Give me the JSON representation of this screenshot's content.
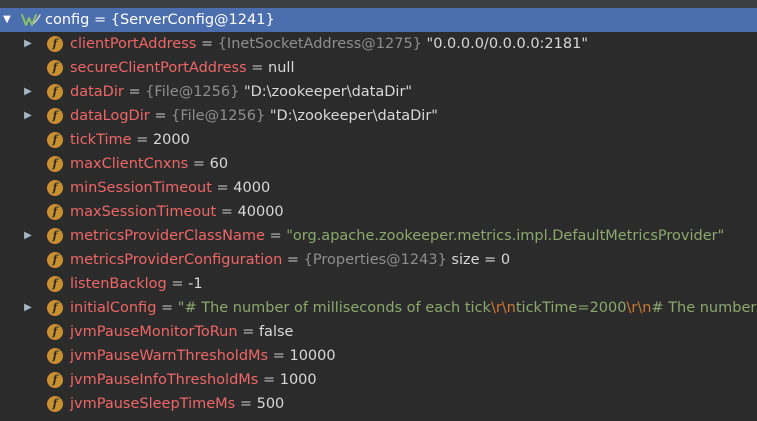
{
  "root": {
    "name": "config",
    "eq": "=",
    "value": "{ServerConfig@1241}"
  },
  "fields": [
    {
      "name": "clientPortAddress",
      "expandable": true,
      "type": "{InetSocketAddress@1275}",
      "value": "\"0.0.0.0/0.0.0.0:2181\""
    },
    {
      "name": "secureClientPortAddress",
      "expandable": false,
      "value": "null"
    },
    {
      "name": "dataDir",
      "expandable": true,
      "type": "{File@1256}",
      "value": "\"D:\\zookeeper\\dataDir\""
    },
    {
      "name": "dataLogDir",
      "expandable": true,
      "type": "{File@1256}",
      "value": "\"D:\\zookeeper\\dataDir\""
    },
    {
      "name": "tickTime",
      "expandable": false,
      "value": "2000"
    },
    {
      "name": "maxClientCnxns",
      "expandable": false,
      "value": "60"
    },
    {
      "name": "minSessionTimeout",
      "expandable": false,
      "value": "4000"
    },
    {
      "name": "maxSessionTimeout",
      "expandable": false,
      "value": "40000"
    },
    {
      "name": "metricsProviderClassName",
      "expandable": true,
      "string": "\"org.apache.zookeeper.metrics.impl.DefaultMetricsProvider\""
    },
    {
      "name": "metricsProviderConfiguration",
      "expandable": false,
      "type": "{Properties@1243}",
      "value": " size = 0"
    },
    {
      "name": "listenBacklog",
      "expandable": false,
      "value": "-1"
    },
    {
      "name": "initialConfig",
      "expandable": true,
      "segments": [
        {
          "kind": "str",
          "text": "\"# The number of milliseconds of each tick"
        },
        {
          "kind": "esc",
          "text": "\\r\\n"
        },
        {
          "kind": "str",
          "text": "tickTime=2000"
        },
        {
          "kind": "esc",
          "text": "\\r\\n"
        },
        {
          "kind": "str",
          "text": "# The number of ticks that the initial"
        }
      ]
    },
    {
      "name": "jvmPauseMonitorToRun",
      "expandable": false,
      "value": "false"
    },
    {
      "name": "jvmPauseWarnThresholdMs",
      "expandable": false,
      "value": "10000"
    },
    {
      "name": "jvmPauseInfoThresholdMs",
      "expandable": false,
      "value": "1000"
    },
    {
      "name": "jvmPauseSleepTimeMs",
      "expandable": false,
      "value": "500"
    }
  ],
  "equals": "=",
  "field_icon_letter": "f",
  "icons": {
    "expand": "chevron-right-icon",
    "collapse": "chevron-down-icon",
    "field": "field-icon",
    "watch": "watch-icon"
  },
  "colors": {
    "background": "#2b2b2b",
    "selection": "#4b6eaf",
    "field_name": "#ee6666",
    "field_icon": "#c8902e",
    "string": "#8ba86d",
    "escape": "#cc7832",
    "type": "#8e8e8e"
  }
}
